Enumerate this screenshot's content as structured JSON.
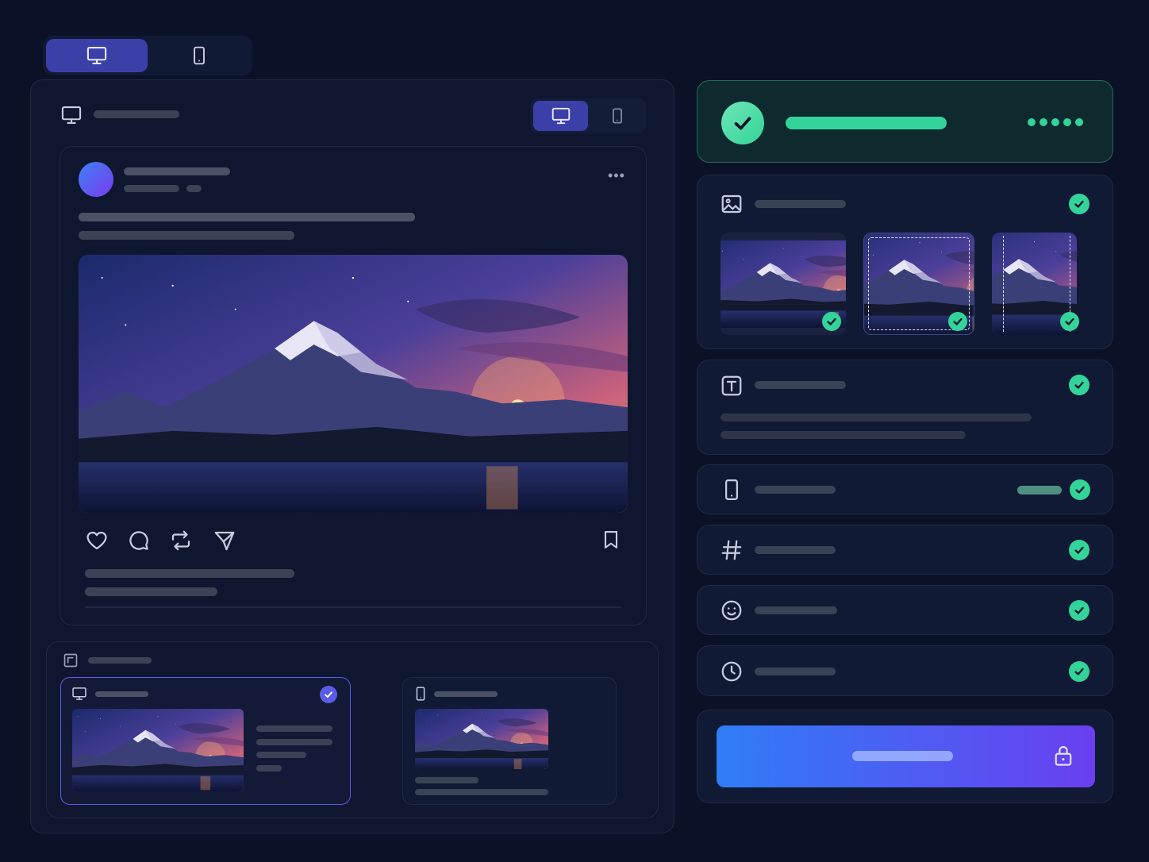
{
  "colors": {
    "background": "#0b1127",
    "accent": "#3b3fa8",
    "success": "#34d399",
    "cta_gradient_start": "#2f7df6",
    "cta_gradient_end": "#6a3ff0"
  },
  "device_switcher": {
    "options": [
      {
        "icon": "desktop-icon",
        "selected": true
      },
      {
        "icon": "mobile-icon",
        "selected": false
      }
    ]
  },
  "preview_panel": {
    "header_icon": "desktop-icon",
    "inner_switcher": [
      {
        "icon": "desktop-icon",
        "selected": true
      },
      {
        "icon": "mobile-icon",
        "selected": false
      }
    ],
    "post": {
      "avatar": "avatar",
      "image": "mountain-sunset-lake",
      "actions": [
        "heart-icon",
        "comment-icon",
        "repost-icon",
        "send-icon"
      ],
      "save_icon": "bookmark-icon"
    },
    "previews": {
      "header_icon": "crop-icon",
      "items": [
        {
          "icon": "desktop-icon",
          "selected": true
        },
        {
          "icon": "mobile-icon",
          "selected": false
        }
      ]
    }
  },
  "checklist": {
    "status": {
      "icon": "check-circle-icon",
      "progress_dots": 5
    },
    "sections": [
      {
        "icon": "image-icon",
        "status": "ok",
        "thumbnails": 3
      },
      {
        "icon": "text-icon",
        "status": "ok"
      },
      {
        "icon": "mobile-icon",
        "status": "ok"
      },
      {
        "icon": "hashtag-icon",
        "status": "ok"
      },
      {
        "icon": "emoji-icon",
        "status": "ok"
      },
      {
        "icon": "clock-icon",
        "status": "ok"
      }
    ],
    "cta": {
      "icon": "lock-icon"
    }
  }
}
